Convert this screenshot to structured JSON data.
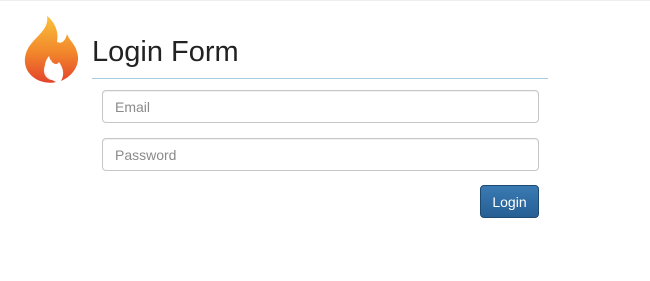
{
  "brand": {
    "logo_icon": "flame-logo-icon",
    "logo_colors": [
      "#f7b731",
      "#f27a2a",
      "#e2452d"
    ]
  },
  "header": {
    "title": "Login Form"
  },
  "form": {
    "email": {
      "placeholder": "Email",
      "value": ""
    },
    "password": {
      "placeholder": "Password",
      "value": ""
    },
    "submit_label": "Login"
  },
  "colors": {
    "accent": "#2d6ca2",
    "header_rule": "#a9cde0"
  }
}
